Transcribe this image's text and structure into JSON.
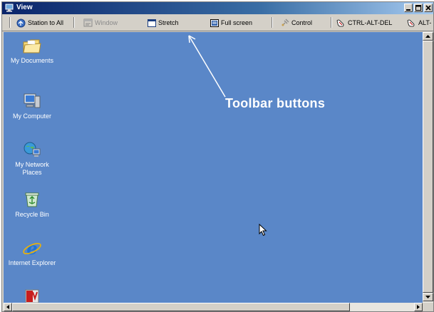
{
  "window": {
    "title": "View"
  },
  "toolbar": {
    "station_to_all": "Station to All",
    "window": "Window",
    "stretch": "Stretch",
    "full_screen": "Full screen",
    "control": "Control",
    "ctrl_alt_del": "CTRL-ALT-DEL",
    "alt": "ALT-"
  },
  "desktop": {
    "background_color": "#5a87c8",
    "icons": [
      {
        "label": "My Documents",
        "icon": "folder-icon"
      },
      {
        "label": "My Computer",
        "icon": "computer-icon"
      },
      {
        "label": "My Network Places",
        "icon": "network-icon"
      },
      {
        "label": "Recycle Bin",
        "icon": "recycle-bin-icon"
      },
      {
        "label": "Internet Explorer",
        "icon": "internet-explorer-icon"
      },
      {
        "label": "",
        "icon": "adobe-reader-icon"
      }
    ]
  },
  "annotation": {
    "text": "Toolbar buttons"
  }
}
